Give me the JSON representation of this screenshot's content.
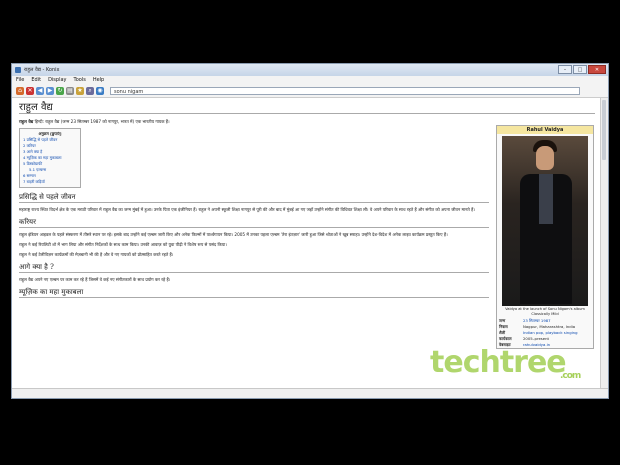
{
  "window": {
    "title": "राहुल वैद्य - Konix",
    "buttons": [
      "–",
      "□",
      "✕"
    ]
  },
  "menu": [
    "File",
    "Edit",
    "Display",
    "Tools",
    "Help"
  ],
  "address": {
    "value": "sonu nigam"
  },
  "article": {
    "heading": "राहुल वैद्य",
    "intro_bold": "राहुल वैद्य",
    "intro": " हिन्दी: राहुल वैद्य (जन्म 23 सितम्बर 1987 को नागपुर, भारत में) एक भारतीय गायक हैं।",
    "toc": {
      "title": "अनुक्रम [छुपाएं]",
      "items": [
        "1 प्रसिद्धि से पहले जीवन",
        "2 करियर",
        "3 आगे क्या है",
        "4 म्यूज़िक का महा मुकाबला",
        "5 डिस्कोग्राफी",
        "5.1 एल्बम्स",
        "6 सम्मान",
        "7 बाहरी कड़ियाँ"
      ]
    },
    "sections": [
      {
        "title": "प्रसिद्धि से पहले जीवन",
        "paras": [
          "महाराष्ट्र राज्य स्थित विदर्भ क्षेत्र के एक मराठी परिवार में राहुल वैद्य का जन्म मुंबई में हुआ। उनके पिता एक इंजीनियर हैं। राहुल ने अपनी स्कूली शिक्षा नागपुर से पूरी की और बाद में मुंबई आ गए जहाँ उन्होंने संगीत की विधिवत शिक्षा ली। वे अपने परिवार के साथ रहते हैं और संगीत को अपना जीवन मानते हैं।"
        ]
      },
      {
        "title": "करियर",
        "paras": [
          "राहुल इंडियन आइडल के पहले संस्करण में तीसरे स्थान पर रहे। इसके बाद उन्होंने कई एल्बम जारी किए और अनेक फिल्मों में पार्श्वगायन किया। 2005 में उनका पहला एल्बम 'तेरा इंतज़ार' जारी हुआ जिसे श्रोताओं ने खूब सराहा। उन्होंने देश-विदेश में अनेक लाइव कार्यक्रम प्रस्तुत किए हैं।",
          "राहुल ने कई रियलिटी शो में भाग लिया और संगीत निर्देशकों के साथ काम किया। उनकी आवाज़ को युवा पीढ़ी ने विशेष रूप से पसंद किया।",
          "राहुल ने कई टेलीविज़न कार्यक्रमों की मेज़बानी भी की है और वे नए गायकों को प्रोत्साहित करते रहते हैं।"
        ]
      },
      {
        "title": "आगे क्या है ?",
        "paras": [
          "राहुल वैद्य अपने नए एल्बम पर काम कर रहे हैं जिसमें वे कई नए संगीतकारों के साथ प्रयोग कर रहे हैं।"
        ]
      },
      {
        "title": "म्यूज़िक का महा मुकाबला",
        "paras": []
      }
    ]
  },
  "infobox": {
    "title": "Rahul Vaidya",
    "caption": "Vaidya at the launch of Sonu Nigam's album Classically Mild",
    "rows": [
      {
        "k": "जन्म",
        "v": "23 सितम्बर 1987"
      },
      {
        "k": "निवास",
        "v": "Nagpur, Maharashtra, India"
      },
      {
        "k": "शैली",
        "v": "Indian pop, playback singing"
      },
      {
        "k": "कार्यकाल",
        "v": "2005–present"
      },
      {
        "k": "वेबसाइट",
        "v": "rahulvaidya.in"
      }
    ]
  },
  "watermark": {
    "main": "techtree",
    "suffix": ".com"
  }
}
